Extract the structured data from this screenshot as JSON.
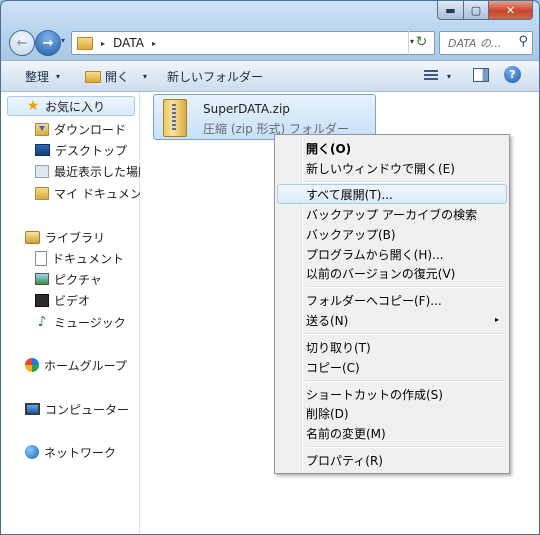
{
  "window": {
    "caption": {
      "minimize": "▬",
      "maximize": "▢",
      "close": "✕"
    }
  },
  "address": {
    "crumb": "DATA",
    "separator": "▸",
    "dropdown": "▾"
  },
  "search": {
    "placeholder": "DATA の..."
  },
  "toolbar": {
    "organize": "整理",
    "open": "開く",
    "new_folder": "新しいフォルダー",
    "arrow": "▾"
  },
  "sidebar": {
    "favorites": "お気に入り",
    "downloads": "ダウンロード",
    "desktop": "デスクトップ",
    "recent": "最近表示した場所",
    "my_documents": "マイ ドキュメント",
    "libraries": "ライブラリ",
    "documents": "ドキュメント",
    "pictures": "ピクチャ",
    "videos": "ビデオ",
    "music": "ミュージック",
    "homegroup": "ホームグループ",
    "computer": "コンピューター",
    "network": "ネットワーク"
  },
  "file": {
    "name": "SuperDATA.zip",
    "type": "圧縮 (zip 形式) フォルダー"
  },
  "context_menu": {
    "open": "開く(O)",
    "open_new_window": "新しいウィンドウで開く(E)",
    "extract_all": "すべて展開(T)...",
    "search_backup_archive": "バックアップ アーカイブの検索",
    "backup": "バックアップ(B)",
    "open_with": "プログラムから開く(H)...",
    "restore_previous": "以前のバージョンの復元(V)",
    "copy_to_folder": "フォルダーへコピー(F)...",
    "send_to": "送る(N)",
    "cut": "切り取り(T)",
    "copy": "コピー(C)",
    "create_shortcut": "ショートカットの作成(S)",
    "delete": "削除(D)",
    "rename": "名前の変更(M)",
    "properties": "プロパティ(R)",
    "submenu_arrow": "▸"
  }
}
